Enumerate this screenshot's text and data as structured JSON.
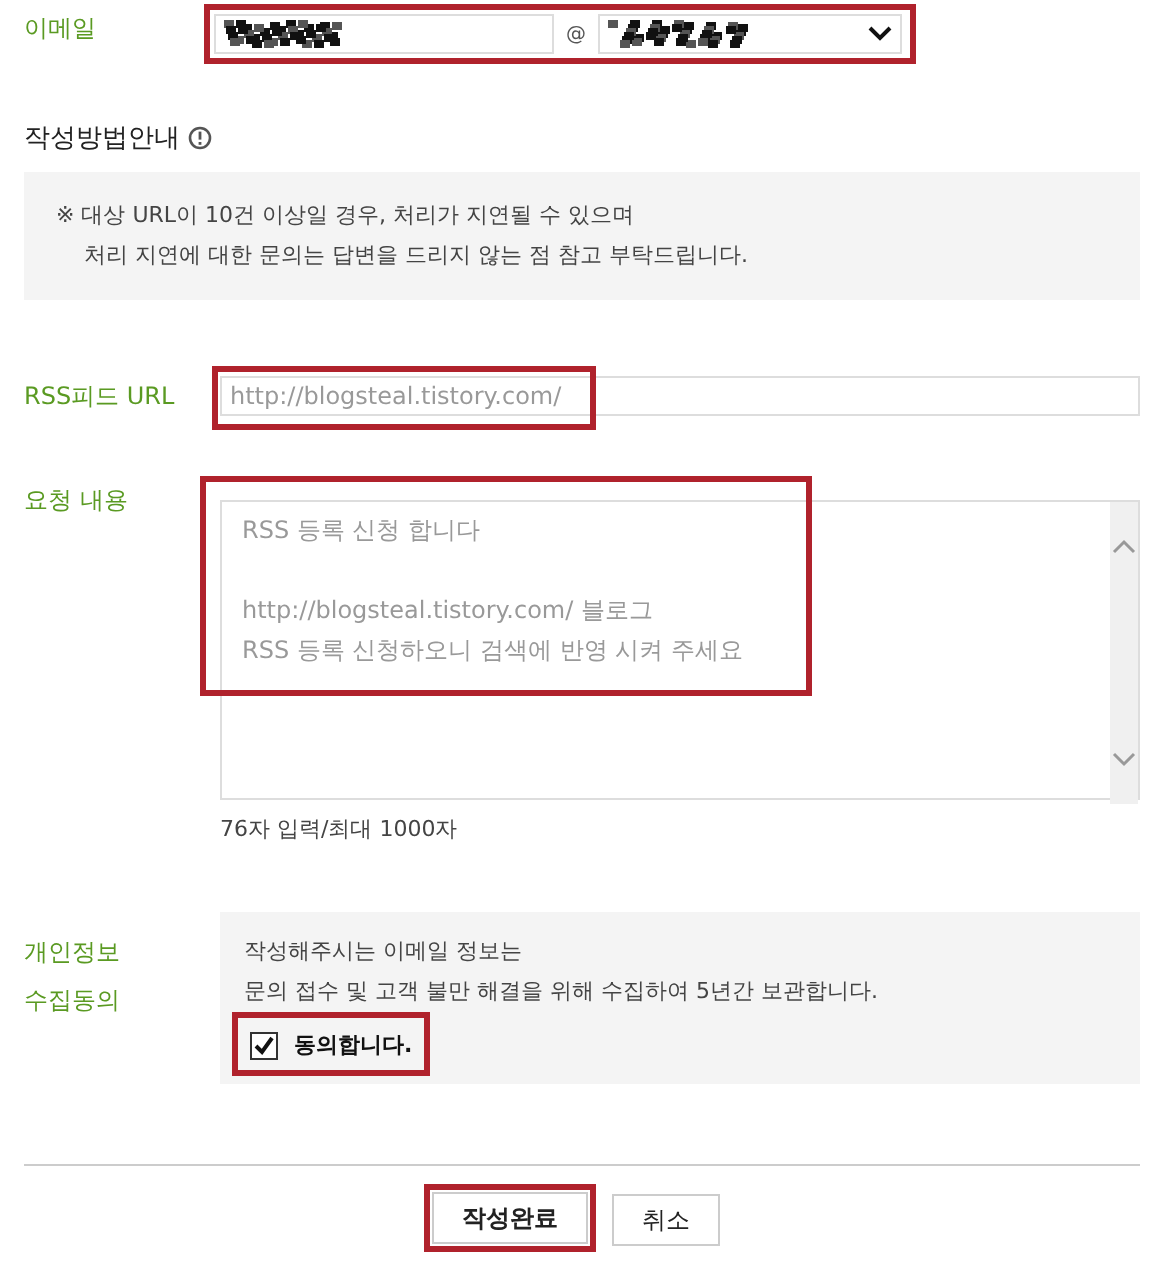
{
  "email": {
    "label": "이메일",
    "separator": "@",
    "highlighted": true
  },
  "guide": {
    "title": "작성방법안내",
    "lines": [
      "※ 대상 URL이 10건 이상일 경우, 처리가 지연될 수 있으며",
      "처리 지연에 대한 문의는 답변을 드리지 않는 점 참고 부탁드립니다."
    ]
  },
  "rss": {
    "label": "RSS피드 URL",
    "placeholder": "http://blogsteal.tistory.com/",
    "highlighted": true
  },
  "request": {
    "label": "요청 내용",
    "placeholder": "RSS 등록 신청 합니다\n\nhttp://blogsteal.tistory.com/ 블로그\nRSS 등록 신청하오니 검색에 반영 시켜 주세요",
    "counter": "76자 입력/최대 1000자",
    "highlighted": true
  },
  "privacy": {
    "label_lines": [
      "개인정보",
      "수집동의"
    ],
    "lines": [
      "작성해주시는 이메일 정보는",
      "문의 접수 및 고객 불만 해결을 위해 수집하여 5년간 보관합니다."
    ],
    "agree_label": "동의합니다.",
    "checked": true,
    "highlighted": true
  },
  "buttons": [
    {
      "label": "작성완료",
      "kind": "primary",
      "highlighted": true
    },
    {
      "label": "취소",
      "kind": "secondary",
      "highlighted": false
    }
  ]
}
